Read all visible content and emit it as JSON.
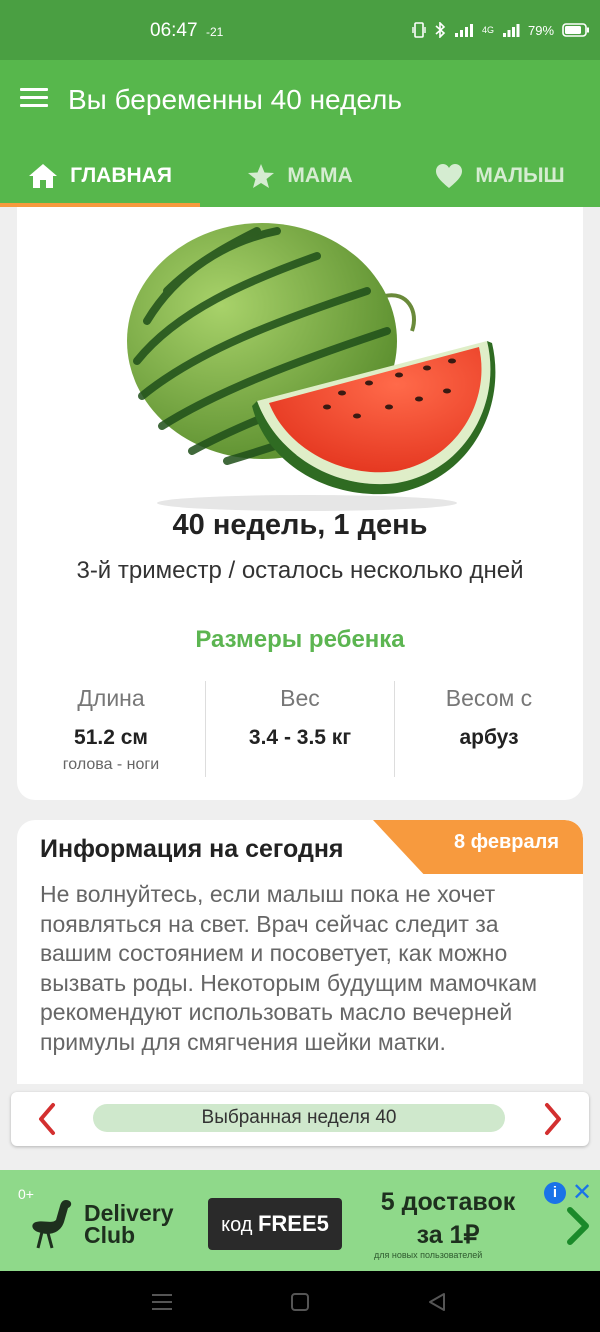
{
  "status_bar": {
    "time": "06:47",
    "temperature": "-21",
    "battery": "79%",
    "network": "4G"
  },
  "app_bar": {
    "title": "Вы беременны 40 недель"
  },
  "tabs": [
    {
      "label": "ГЛАВНАЯ",
      "icon": "home-icon",
      "active": true
    },
    {
      "label": "МАМА",
      "icon": "star-icon",
      "active": false
    },
    {
      "label": "МАЛЫШ",
      "icon": "heart-icon",
      "active": false
    }
  ],
  "week_card": {
    "fruit_icon": "watermelon-image",
    "week_title": "40 недель, 1 день",
    "trimester": "3-й триместр / осталось несколько дней",
    "sizes_title": "Размеры ребенка",
    "stats": [
      {
        "label": "Длина",
        "value": "51.2 см",
        "sub": "голова - ноги"
      },
      {
        "label": "Вес",
        "value": "3.4 - 3.5 кг",
        "sub": ""
      },
      {
        "label": "Весом с",
        "value": "арбуз",
        "sub": ""
      }
    ]
  },
  "info_card": {
    "title": "Информация на сегодня",
    "date_badge": "8 февраля",
    "text": "Не волнуйтесь, если малыш пока не хочет появляться на свет. Врач сейчас следит за вашим состоянием и посоветует, как можно вызвать роды. Некоторым будущим мамочкам рекомендуют использовать масло вечерней примулы для смягчения шейки матки."
  },
  "week_selector": {
    "label": "Выбранная неделя 40"
  },
  "ad": {
    "age": "0+",
    "brand_line1": "Delivery",
    "brand_line2": "Club",
    "code_prefix": "код",
    "code": "FREE5",
    "offer_line1": "5 доставок",
    "offer_line2": "за 1₽",
    "fine_print": "для новых пользователей"
  },
  "colors": {
    "primary": "#57b74c",
    "status": "#4a9f42",
    "accent": "#f79a3e",
    "highlight": "#5cb551",
    "nav_arrow": "#d32f2f"
  }
}
